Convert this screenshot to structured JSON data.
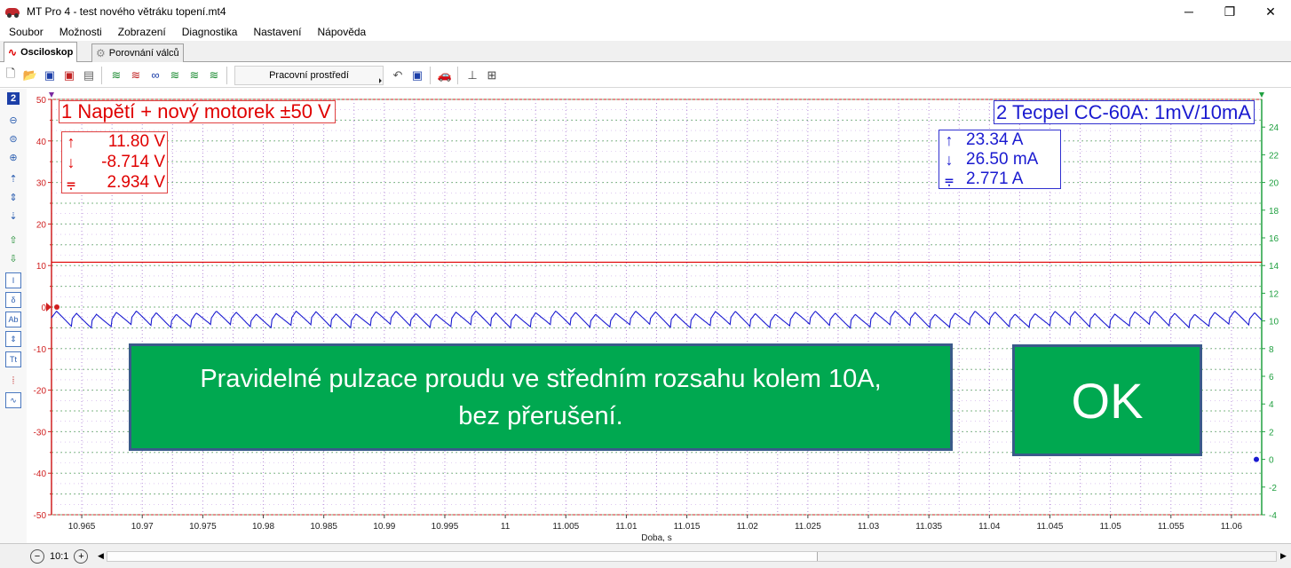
{
  "window": {
    "title": "MT Pro 4 - test nového větráku topení.mt4",
    "min_label": "─",
    "max_label": "❐",
    "close_label": "✕"
  },
  "menu": [
    "Soubor",
    "Možnosti",
    "Zobrazení",
    "Diagnostika",
    "Nastavení",
    "Nápověda"
  ],
  "tabs": [
    {
      "label": "Osciloskop",
      "active": true
    },
    {
      "label": "Porovnání válců",
      "active": false
    }
  ],
  "toolbar": {
    "workspace_label": "Pracovní prostředí"
  },
  "channel1": {
    "label": "1 Napětí + nový motorek  ±50 V",
    "max": "11.80 V",
    "min": "-8.714 V",
    "avg": "2.934 V",
    "color": "#e00000"
  },
  "channel2": {
    "label": "2 Tecpel CC-60A: 1mV/10mA",
    "max": "23.34 A",
    "min": "26.50 mA",
    "avg": "2.771 A",
    "color": "#1a1ad0"
  },
  "note": {
    "line1": "Pravidelné pulzace proudu ve středním rozsahu kolem 10A,",
    "line2": "bez přerušení."
  },
  "ok_label": "OK",
  "chart_data": {
    "type": "line",
    "xlabel": "Doba, s",
    "xlim": [
      10.9625,
      11.0625
    ],
    "x_ticks": [
      "10.965",
      "10.97",
      "10.975",
      "10.98",
      "10.985",
      "10.99",
      "10.995",
      "11",
      "11.005",
      "11.01",
      "11.015",
      "11.02",
      "11.025",
      "11.03",
      "11.035",
      "11.04",
      "11.045",
      "11.05",
      "11.055",
      "11.06"
    ],
    "x_tick_values": [
      10.965,
      10.97,
      10.975,
      10.98,
      10.985,
      10.99,
      10.995,
      11,
      11.005,
      11.01,
      11.015,
      11.02,
      11.025,
      11.03,
      11.035,
      11.04,
      11.045,
      11.05,
      11.055,
      11.06
    ],
    "left_ylim": [
      -50,
      50
    ],
    "left_ticks": [
      "50",
      "40",
      "30",
      "20",
      "10",
      "0",
      "-10",
      "-20",
      "-30",
      "-40",
      "-50"
    ],
    "left_tick_values": [
      50,
      40,
      30,
      20,
      10,
      0,
      -10,
      -20,
      -30,
      -40,
      -50
    ],
    "right_ylim": [
      -4,
      26
    ],
    "right_ticks": [
      "24",
      "22",
      "20",
      "18",
      "16",
      "14",
      "12",
      "10",
      "8",
      "6",
      "4",
      "2",
      "0",
      "-2",
      "-4"
    ],
    "right_tick_values": [
      24,
      22,
      20,
      18,
      16,
      14,
      12,
      10,
      8,
      6,
      4,
      2,
      0,
      -2,
      -4
    ],
    "series": [
      {
        "name": "1 Napětí + nový motorek  ±50 V",
        "axis": "left",
        "color": "#e00000",
        "constant": 10.8
      },
      {
        "name": "2 Tecpel CC-60A: 1mV/10mA",
        "axis": "right",
        "color": "#1a1ad0",
        "mean": 10.1,
        "amplitude": 0.55,
        "period_s": 0.00165
      }
    ],
    "grid": true
  },
  "bottom": {
    "zoom_label": "10:1"
  }
}
